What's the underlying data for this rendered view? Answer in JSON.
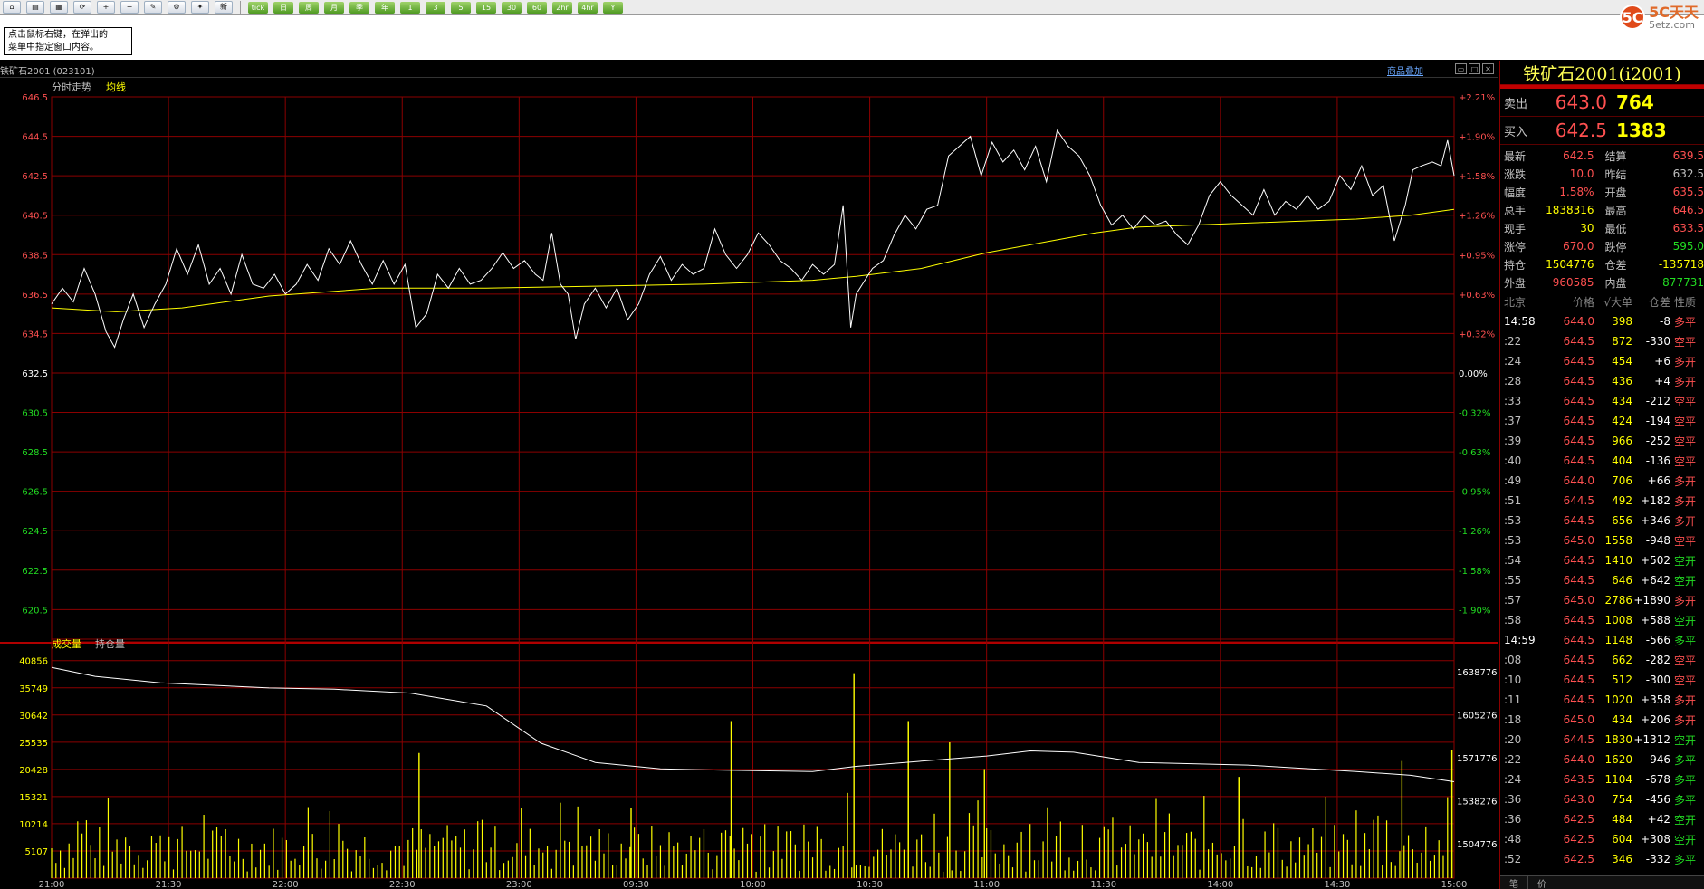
{
  "toolbar": {
    "icons": [
      "home-icon",
      "folder-icon",
      "report-icon",
      "refresh-icon",
      "zoom-in-icon",
      "zoom-out-icon",
      "draw-icon",
      "setting-icon",
      "pin-icon"
    ],
    "new_label": "新",
    "periods": [
      "tick",
      "日",
      "周",
      "月",
      "季",
      "年",
      "1",
      "3",
      "5",
      "15",
      "30",
      "60",
      "2hr",
      "4hr",
      "Y"
    ]
  },
  "brand": {
    "logo": "5C",
    "name": "5C天天",
    "sub": "5etz.com"
  },
  "hint": {
    "line1": "点击鼠标右键，在弹出的",
    "line2": "菜单中指定窗口内容。"
  },
  "symbol": {
    "title": "铁矿石2001 (023101)",
    "overlay_link": "商品叠加",
    "panel_title": "铁矿石2001(i2001)"
  },
  "chart_labels": {
    "price_legend_1": "分时走势",
    "price_legend_2": "均线",
    "volume_legend_1": "成交量",
    "volume_legend_2": "持仓量"
  },
  "colors": {
    "grid": "#8b0000",
    "price_line": "#ffffff",
    "avg_line": "#ffff00",
    "volume_bar": "#ffff00",
    "up": "#ff5050",
    "down": "#22dd22",
    "axis_text_up": "#ff5050"
  },
  "chart_data": {
    "type": "line",
    "price_axis": {
      "ticks": [
        "646.5",
        "644.5",
        "642.5",
        "640.5",
        "638.5",
        "636.5",
        "634.5",
        "632.5",
        "630.5",
        "628.5",
        "626.5",
        "624.5",
        "622.5",
        "620.5"
      ],
      "ylim": [
        619.0,
        646.5
      ],
      "prev_settle": 632.5
    },
    "percent_axis": {
      "ticks": [
        "+2.21%",
        "+1.90%",
        "+1.58%",
        "+1.26%",
        "+0.95%",
        "+0.63%",
        "+0.32%",
        "0.00%",
        "-0.32%",
        "-0.63%",
        "-0.95%",
        "-1.26%",
        "-1.58%",
        "-1.90%"
      ]
    },
    "time_axis": {
      "ticks": [
        "21:00",
        "21:30",
        "22:00",
        "22:30",
        "23:00",
        "09:30",
        "10:00",
        "10:30",
        "11:00",
        "11:30",
        "14:00",
        "14:30",
        "15:00"
      ]
    },
    "volume_axis": {
      "ticks": [
        "40856",
        "35749",
        "30642",
        "25535",
        "20428",
        "15321",
        "10214",
        "5107"
      ],
      "max": 42000
    },
    "oi_axis": {
      "ticks": [
        "1638776",
        "1605276",
        "1571776",
        "1538276",
        "1504776"
      ],
      "range": [
        1478000,
        1652000
      ]
    },
    "price_series": [
      {
        "x": 0,
        "y": 636.0
      },
      {
        "x": 10,
        "y": 636.8
      },
      {
        "x": 20,
        "y": 636.1
      },
      {
        "x": 30,
        "y": 637.8
      },
      {
        "x": 40,
        "y": 636.5
      },
      {
        "x": 50,
        "y": 634.6
      },
      {
        "x": 58,
        "y": 633.8
      },
      {
        "x": 66,
        "y": 635.2
      },
      {
        "x": 75,
        "y": 636.5
      },
      {
        "x": 85,
        "y": 634.8
      },
      {
        "x": 95,
        "y": 636.0
      },
      {
        "x": 105,
        "y": 637.0
      },
      {
        "x": 115,
        "y": 638.8
      },
      {
        "x": 125,
        "y": 637.5
      },
      {
        "x": 135,
        "y": 639.0
      },
      {
        "x": 145,
        "y": 637.0
      },
      {
        "x": 155,
        "y": 637.8
      },
      {
        "x": 165,
        "y": 636.5
      },
      {
        "x": 175,
        "y": 638.5
      },
      {
        "x": 185,
        "y": 637.0
      },
      {
        "x": 195,
        "y": 636.8
      },
      {
        "x": 205,
        "y": 637.5
      },
      {
        "x": 215,
        "y": 636.5
      },
      {
        "x": 225,
        "y": 637.0
      },
      {
        "x": 235,
        "y": 638.0
      },
      {
        "x": 245,
        "y": 637.2
      },
      {
        "x": 255,
        "y": 638.8
      },
      {
        "x": 265,
        "y": 638.0
      },
      {
        "x": 275,
        "y": 639.2
      },
      {
        "x": 285,
        "y": 638.0
      },
      {
        "x": 295,
        "y": 637.0
      },
      {
        "x": 305,
        "y": 638.2
      },
      {
        "x": 315,
        "y": 637.0
      },
      {
        "x": 325,
        "y": 638.0
      },
      {
        "x": 335,
        "y": 634.8
      },
      {
        "x": 345,
        "y": 635.5
      },
      {
        "x": 355,
        "y": 637.5
      },
      {
        "x": 365,
        "y": 636.8
      },
      {
        "x": 375,
        "y": 637.8
      },
      {
        "x": 385,
        "y": 637.0
      },
      {
        "x": 395,
        "y": 637.2
      },
      {
        "x": 405,
        "y": 637.8
      },
      {
        "x": 415,
        "y": 638.6
      },
      {
        "x": 425,
        "y": 637.8
      },
      {
        "x": 435,
        "y": 638.2
      },
      {
        "x": 445,
        "y": 637.5
      },
      {
        "x": 452,
        "y": 637.2
      },
      {
        "x": 460,
        "y": 639.6
      },
      {
        "x": 468,
        "y": 637.0
      },
      {
        "x": 475,
        "y": 636.5
      },
      {
        "x": 482,
        "y": 634.2
      },
      {
        "x": 490,
        "y": 636.0
      },
      {
        "x": 500,
        "y": 636.8
      },
      {
        "x": 510,
        "y": 635.8
      },
      {
        "x": 520,
        "y": 636.8
      },
      {
        "x": 530,
        "y": 635.2
      },
      {
        "x": 540,
        "y": 636.0
      },
      {
        "x": 550,
        "y": 637.5
      },
      {
        "x": 560,
        "y": 638.4
      },
      {
        "x": 570,
        "y": 637.2
      },
      {
        "x": 580,
        "y": 638.0
      },
      {
        "x": 590,
        "y": 637.5
      },
      {
        "x": 600,
        "y": 637.8
      },
      {
        "x": 610,
        "y": 639.8
      },
      {
        "x": 620,
        "y": 638.5
      },
      {
        "x": 630,
        "y": 637.8
      },
      {
        "x": 640,
        "y": 638.5
      },
      {
        "x": 650,
        "y": 639.6
      },
      {
        "x": 660,
        "y": 639.0
      },
      {
        "x": 670,
        "y": 638.2
      },
      {
        "x": 680,
        "y": 637.8
      },
      {
        "x": 690,
        "y": 637.2
      },
      {
        "x": 700,
        "y": 638.0
      },
      {
        "x": 710,
        "y": 637.5
      },
      {
        "x": 720,
        "y": 638.0
      },
      {
        "x": 728,
        "y": 641.0
      },
      {
        "x": 735,
        "y": 634.8
      },
      {
        "x": 740,
        "y": 636.5
      },
      {
        "x": 748,
        "y": 637.2
      },
      {
        "x": 755,
        "y": 637.8
      },
      {
        "x": 765,
        "y": 638.2
      },
      {
        "x": 775,
        "y": 639.5
      },
      {
        "x": 785,
        "y": 640.5
      },
      {
        "x": 795,
        "y": 639.8
      },
      {
        "x": 805,
        "y": 640.8
      },
      {
        "x": 815,
        "y": 641.0
      },
      {
        "x": 825,
        "y": 643.5
      },
      {
        "x": 835,
        "y": 644.0
      },
      {
        "x": 845,
        "y": 644.5
      },
      {
        "x": 855,
        "y": 642.5
      },
      {
        "x": 865,
        "y": 644.2
      },
      {
        "x": 875,
        "y": 643.2
      },
      {
        "x": 885,
        "y": 643.8
      },
      {
        "x": 895,
        "y": 642.8
      },
      {
        "x": 905,
        "y": 644.0
      },
      {
        "x": 915,
        "y": 642.2
      },
      {
        "x": 925,
        "y": 644.8
      },
      {
        "x": 935,
        "y": 644.0
      },
      {
        "x": 945,
        "y": 643.5
      },
      {
        "x": 955,
        "y": 642.5
      },
      {
        "x": 965,
        "y": 641.0
      },
      {
        "x": 975,
        "y": 640.0
      },
      {
        "x": 985,
        "y": 640.5
      },
      {
        "x": 995,
        "y": 639.8
      },
      {
        "x": 1005,
        "y": 640.5
      },
      {
        "x": 1015,
        "y": 640.0
      },
      {
        "x": 1025,
        "y": 640.2
      },
      {
        "x": 1035,
        "y": 639.5
      },
      {
        "x": 1045,
        "y": 639.0
      },
      {
        "x": 1055,
        "y": 640.0
      },
      {
        "x": 1065,
        "y": 641.5
      },
      {
        "x": 1075,
        "y": 642.2
      },
      {
        "x": 1085,
        "y": 641.5
      },
      {
        "x": 1095,
        "y": 641.0
      },
      {
        "x": 1105,
        "y": 640.5
      },
      {
        "x": 1115,
        "y": 641.8
      },
      {
        "x": 1125,
        "y": 640.5
      },
      {
        "x": 1135,
        "y": 641.2
      },
      {
        "x": 1145,
        "y": 640.8
      },
      {
        "x": 1155,
        "y": 641.5
      },
      {
        "x": 1165,
        "y": 640.8
      },
      {
        "x": 1175,
        "y": 641.2
      },
      {
        "x": 1185,
        "y": 642.5
      },
      {
        "x": 1195,
        "y": 641.8
      },
      {
        "x": 1205,
        "y": 643.0
      },
      {
        "x": 1215,
        "y": 641.5
      },
      {
        "x": 1225,
        "y": 642.0
      },
      {
        "x": 1235,
        "y": 639.2
      },
      {
        "x": 1245,
        "y": 641.0
      },
      {
        "x": 1252,
        "y": 642.8
      },
      {
        "x": 1260,
        "y": 643.0
      },
      {
        "x": 1270,
        "y": 643.2
      },
      {
        "x": 1278,
        "y": 643.0
      },
      {
        "x": 1284,
        "y": 644.3
      },
      {
        "x": 1290,
        "y": 642.5
      }
    ],
    "avg_series": [
      {
        "x": 0,
        "y": 635.8
      },
      {
        "x": 60,
        "y": 635.6
      },
      {
        "x": 120,
        "y": 635.8
      },
      {
        "x": 200,
        "y": 636.4
      },
      {
        "x": 300,
        "y": 636.8
      },
      {
        "x": 400,
        "y": 636.8
      },
      {
        "x": 500,
        "y": 636.9
      },
      {
        "x": 600,
        "y": 637.0
      },
      {
        "x": 700,
        "y": 637.2
      },
      {
        "x": 740,
        "y": 637.4
      },
      {
        "x": 800,
        "y": 637.8
      },
      {
        "x": 860,
        "y": 638.6
      },
      {
        "x": 920,
        "y": 639.2
      },
      {
        "x": 960,
        "y": 639.6
      },
      {
        "x": 1000,
        "y": 639.9
      },
      {
        "x": 1100,
        "y": 640.1
      },
      {
        "x": 1200,
        "y": 640.3
      },
      {
        "x": 1250,
        "y": 640.5
      },
      {
        "x": 1290,
        "y": 640.8
      }
    ],
    "oi_series": [
      {
        "x": 0,
        "y": 1642000
      },
      {
        "x": 40,
        "y": 1635000
      },
      {
        "x": 100,
        "y": 1630000
      },
      {
        "x": 200,
        "y": 1626000
      },
      {
        "x": 260,
        "y": 1625000
      },
      {
        "x": 330,
        "y": 1622000
      },
      {
        "x": 400,
        "y": 1612000
      },
      {
        "x": 450,
        "y": 1583000
      },
      {
        "x": 500,
        "y": 1568000
      },
      {
        "x": 560,
        "y": 1563000
      },
      {
        "x": 620,
        "y": 1562000
      },
      {
        "x": 700,
        "y": 1561000
      },
      {
        "x": 740,
        "y": 1565000
      },
      {
        "x": 800,
        "y": 1569000
      },
      {
        "x": 860,
        "y": 1573000
      },
      {
        "x": 900,
        "y": 1577000
      },
      {
        "x": 940,
        "y": 1576000
      },
      {
        "x": 1000,
        "y": 1568000
      },
      {
        "x": 1100,
        "y": 1566000
      },
      {
        "x": 1200,
        "y": 1561000
      },
      {
        "x": 1250,
        "y": 1558000
      },
      {
        "x": 1290,
        "y": 1553000
      }
    ],
    "volume_spikes": [
      {
        "x": 338,
        "v": 23500
      },
      {
        "x": 533,
        "v": 13200
      },
      {
        "x": 625,
        "v": 29500
      },
      {
        "x": 732,
        "v": 16000
      },
      {
        "x": 738,
        "v": 38500
      },
      {
        "x": 788,
        "v": 29500
      },
      {
        "x": 826,
        "v": 25500
      },
      {
        "x": 858,
        "v": 20500
      },
      {
        "x": 1092,
        "v": 19000
      },
      {
        "x": 1242,
        "v": 22000
      },
      {
        "x": 1288,
        "v": 24000
      }
    ]
  },
  "orderbook": {
    "ask": {
      "label": "卖出",
      "price": "643.0",
      "volume": "764"
    },
    "bid": {
      "label": "买入",
      "price": "642.5",
      "volume": "1383"
    }
  },
  "stats": [
    {
      "l": "最新",
      "v": "642.5",
      "c": "#ff5050",
      "l2": "结算",
      "v2": "639.5",
      "c2": "#ff5050"
    },
    {
      "l": "涨跌",
      "v": "10.0",
      "c": "#ff5050",
      "l2": "昨结",
      "v2": "632.5",
      "c2": "#c0c0c0"
    },
    {
      "l": "幅度",
      "v": "1.58%",
      "c": "#ff5050",
      "l2": "开盘",
      "v2": "635.5",
      "c2": "#ff5050"
    },
    {
      "l": "总手",
      "v": "1838316",
      "c": "#ffff00",
      "l2": "最高",
      "v2": "646.5",
      "c2": "#ff5050"
    },
    {
      "l": "现手",
      "v": "30",
      "c": "#ffff00",
      "l2": "最低",
      "v2": "633.5",
      "c2": "#ff5050"
    },
    {
      "l": "涨停",
      "v": "670.0",
      "c": "#ff5050",
      "l2": "跌停",
      "v2": "595.0",
      "c2": "#22dd22"
    },
    {
      "l": "持仓",
      "v": "1504776",
      "c": "#ffff00",
      "l2": "仓差",
      "v2": "-135718",
      "c2": "#ffff00"
    },
    {
      "l": "外盘",
      "v": "960585",
      "c": "#ff5050",
      "l2": "内盘",
      "v2": "877731",
      "c2": "#22dd22"
    }
  ],
  "ticks_header": {
    "time": "北京",
    "price": "价格",
    "volume": "√大单",
    "oi": "仓差",
    "nature": "性质"
  },
  "ticks": [
    {
      "t": "14:58",
      "p": "644.0",
      "v": "398",
      "o": "-8",
      "n": "多平",
      "tc": "#ffffff",
      "pc": "#ff5050",
      "oc": "#ffffff",
      "nc": "#ff5050"
    },
    {
      "t": ":22",
      "p": "644.5",
      "v": "872",
      "o": "-330",
      "n": "空平",
      "tc": "#c0c0c0",
      "pc": "#ff5050",
      "oc": "#ffffff",
      "nc": "#ff5050"
    },
    {
      "t": ":24",
      "p": "644.5",
      "v": "454",
      "o": "+6",
      "n": "多开",
      "tc": "#c0c0c0",
      "pc": "#ff5050",
      "oc": "#ffffff",
      "nc": "#ff5050"
    },
    {
      "t": ":28",
      "p": "644.5",
      "v": "436",
      "o": "+4",
      "n": "多开",
      "tc": "#c0c0c0",
      "pc": "#ff5050",
      "oc": "#ffffff",
      "nc": "#ff5050"
    },
    {
      "t": ":33",
      "p": "644.5",
      "v": "434",
      "o": "-212",
      "n": "空平",
      "tc": "#c0c0c0",
      "pc": "#ff5050",
      "oc": "#ffffff",
      "nc": "#ff5050"
    },
    {
      "t": ":37",
      "p": "644.5",
      "v": "424",
      "o": "-194",
      "n": "空平",
      "tc": "#c0c0c0",
      "pc": "#ff5050",
      "oc": "#ffffff",
      "nc": "#ff5050"
    },
    {
      "t": ":39",
      "p": "644.5",
      "v": "966",
      "o": "-252",
      "n": "空平",
      "tc": "#c0c0c0",
      "pc": "#ff5050",
      "oc": "#ffffff",
      "nc": "#ff5050"
    },
    {
      "t": ":40",
      "p": "644.5",
      "v": "404",
      "o": "-136",
      "n": "空平",
      "tc": "#c0c0c0",
      "pc": "#ff5050",
      "oc": "#ffffff",
      "nc": "#ff5050"
    },
    {
      "t": ":49",
      "p": "644.0",
      "v": "706",
      "o": "+66",
      "n": "多开",
      "tc": "#c0c0c0",
      "pc": "#ff5050",
      "oc": "#ffffff",
      "nc": "#ff5050"
    },
    {
      "t": ":51",
      "p": "644.5",
      "v": "492",
      "o": "+182",
      "n": "多开",
      "tc": "#c0c0c0",
      "pc": "#ff5050",
      "oc": "#ffffff",
      "nc": "#ff5050"
    },
    {
      "t": ":53",
      "p": "644.5",
      "v": "656",
      "o": "+346",
      "n": "多开",
      "tc": "#c0c0c0",
      "pc": "#ff5050",
      "oc": "#ffffff",
      "nc": "#ff5050"
    },
    {
      "t": ":53",
      "p": "645.0",
      "v": "1558",
      "o": "-948",
      "n": "空平",
      "tc": "#c0c0c0",
      "pc": "#ff5050",
      "oc": "#ffffff",
      "nc": "#ff5050"
    },
    {
      "t": ":54",
      "p": "644.5",
      "v": "1410",
      "o": "+502",
      "n": "空开",
      "tc": "#c0c0c0",
      "pc": "#ff5050",
      "oc": "#ffffff",
      "nc": "#22dd22"
    },
    {
      "t": ":55",
      "p": "644.5",
      "v": "646",
      "o": "+642",
      "n": "空开",
      "tc": "#c0c0c0",
      "pc": "#ff5050",
      "oc": "#ffffff",
      "nc": "#22dd22"
    },
    {
      "t": ":57",
      "p": "645.0",
      "v": "2786",
      "o": "+1890",
      "n": "多开",
      "tc": "#c0c0c0",
      "pc": "#ff5050",
      "oc": "#ffffff",
      "nc": "#ff5050"
    },
    {
      "t": ":58",
      "p": "644.5",
      "v": "1008",
      "o": "+588",
      "n": "空开",
      "tc": "#c0c0c0",
      "pc": "#ff5050",
      "oc": "#ffffff",
      "nc": "#22dd22"
    },
    {
      "t": "14:59",
      "p": "644.5",
      "v": "1148",
      "o": "-566",
      "n": "多平",
      "tc": "#ffffff",
      "pc": "#ff5050",
      "oc": "#ffffff",
      "nc": "#22dd22"
    },
    {
      "t": ":08",
      "p": "644.5",
      "v": "662",
      "o": "-282",
      "n": "空平",
      "tc": "#c0c0c0",
      "pc": "#ff5050",
      "oc": "#ffffff",
      "nc": "#ff5050"
    },
    {
      "t": ":10",
      "p": "644.5",
      "v": "512",
      "o": "-300",
      "n": "空平",
      "tc": "#c0c0c0",
      "pc": "#ff5050",
      "oc": "#ffffff",
      "nc": "#ff5050"
    },
    {
      "t": ":11",
      "p": "644.5",
      "v": "1020",
      "o": "+358",
      "n": "多开",
      "tc": "#c0c0c0",
      "pc": "#ff5050",
      "oc": "#ffffff",
      "nc": "#ff5050"
    },
    {
      "t": ":18",
      "p": "645.0",
      "v": "434",
      "o": "+206",
      "n": "多开",
      "tc": "#c0c0c0",
      "pc": "#ff5050",
      "oc": "#ffffff",
      "nc": "#ff5050"
    },
    {
      "t": ":20",
      "p": "644.5",
      "v": "1830",
      "o": "+1312",
      "n": "空开",
      "tc": "#c0c0c0",
      "pc": "#ff5050",
      "oc": "#ffffff",
      "nc": "#22dd22"
    },
    {
      "t": ":22",
      "p": "644.0",
      "v": "1620",
      "o": "-946",
      "n": "多平",
      "tc": "#c0c0c0",
      "pc": "#ff5050",
      "oc": "#ffffff",
      "nc": "#22dd22"
    },
    {
      "t": ":24",
      "p": "643.5",
      "v": "1104",
      "o": "-678",
      "n": "多平",
      "tc": "#c0c0c0",
      "pc": "#ff5050",
      "oc": "#ffffff",
      "nc": "#22dd22"
    },
    {
      "t": ":36",
      "p": "643.0",
      "v": "754",
      "o": "-456",
      "n": "多平",
      "tc": "#c0c0c0",
      "pc": "#ff5050",
      "oc": "#ffffff",
      "nc": "#22dd22"
    },
    {
      "t": ":36",
      "p": "642.5",
      "v": "484",
      "o": "+42",
      "n": "空开",
      "tc": "#c0c0c0",
      "pc": "#ff5050",
      "oc": "#ffffff",
      "nc": "#22dd22"
    },
    {
      "t": ":48",
      "p": "642.5",
      "v": "604",
      "o": "+308",
      "n": "空开",
      "tc": "#c0c0c0",
      "pc": "#ff5050",
      "oc": "#ffffff",
      "nc": "#22dd22"
    },
    {
      "t": ":52",
      "p": "642.5",
      "v": "346",
      "o": "-332",
      "n": "多平",
      "tc": "#c0c0c0",
      "pc": "#ff5050",
      "oc": "#ffffff",
      "nc": "#22dd22"
    }
  ],
  "bottom_tabs": [
    "笔",
    "价"
  ]
}
